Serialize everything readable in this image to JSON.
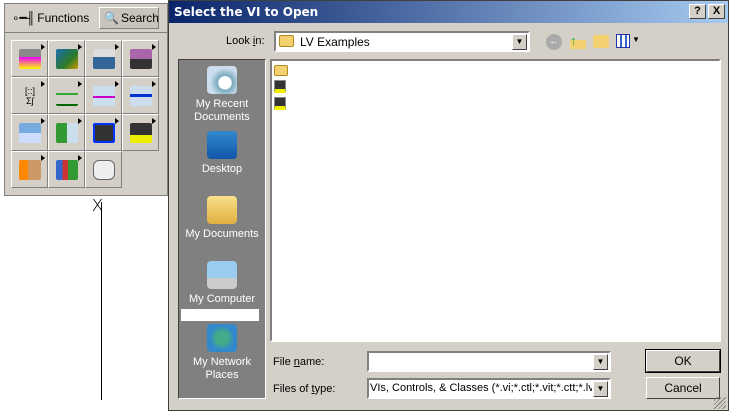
{
  "palette": {
    "functions_tab": "Functions",
    "search_tab": "Search",
    "cells": [
      "programming",
      "measurement-io",
      "instrument-io",
      "vision-motion",
      "mathematics",
      "signal-processing",
      "data-communication",
      "connectivity",
      "control-design",
      "express",
      "select-vi",
      "fpga",
      "user-libraries",
      "addons",
      "favorites"
    ]
  },
  "dialog": {
    "title": "Select the VI to Open",
    "help_button": "?",
    "close_button": "X",
    "look_in_label_pre": "Look ",
    "look_in_label_u": "i",
    "look_in_label_post": "n:",
    "look_in_value": "LV Examples",
    "places": [
      "My Recent Documents",
      "Desktop",
      "My Documents",
      "My Computer",
      "My Network Places"
    ],
    "files": [
      "folder",
      "vi",
      "vi"
    ],
    "file_name_label_pre": "File ",
    "file_name_label_u": "n",
    "file_name_label_post": "ame:",
    "file_name_value": "",
    "file_type_label_pre": "Files of ",
    "file_type_label_u": "t",
    "file_type_label_post": "ype:",
    "file_type_value": "VIs, Controls, & Classes (*.vi;*.ctl;*.vit;*.ctt;*.lvcla",
    "ok": "OK",
    "cancel": "Cancel"
  }
}
